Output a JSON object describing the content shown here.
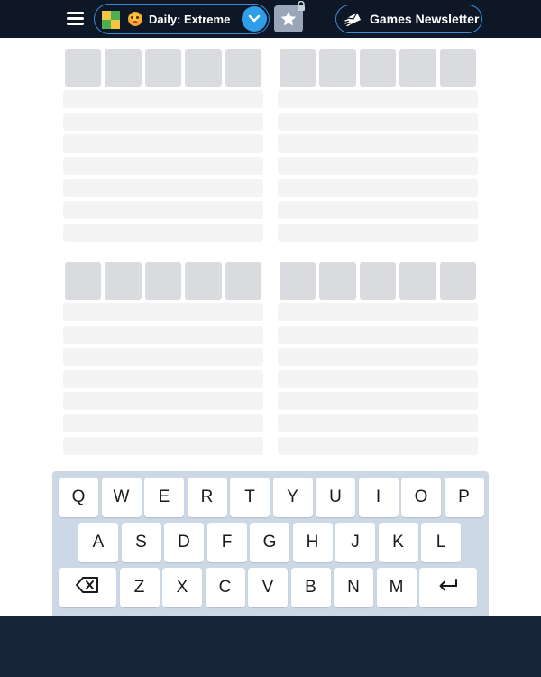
{
  "header": {
    "mode_label": "Daily: Extreme",
    "newsletter_label": "Games Newsletter",
    "icons": {
      "menu": "hamburger-icon",
      "logo": "grid-logo",
      "mode_emoji": "angry-face-emoji",
      "dropdown": "chevron-down-icon",
      "favorite": "star-icon",
      "locked": "lock-icon",
      "newsletter": "envelope-icon"
    }
  },
  "boards": [
    {
      "tiles": 5,
      "rows": 7
    },
    {
      "tiles": 5,
      "rows": 7
    },
    {
      "tiles": 5,
      "rows": 7
    },
    {
      "tiles": 5,
      "rows": 7
    }
  ],
  "keyboard": {
    "rows": [
      [
        "Q",
        "W",
        "E",
        "R",
        "T",
        "Y",
        "U",
        "I",
        "O",
        "P"
      ],
      [
        "A",
        "S",
        "D",
        "F",
        "G",
        "H",
        "J",
        "K",
        "L"
      ],
      [
        "⌫",
        "Z",
        "X",
        "C",
        "V",
        "B",
        "N",
        "M",
        "↵"
      ]
    ],
    "special_keys": {
      "⌫": "backspace-icon",
      "↵": "enter-icon"
    }
  },
  "colors": {
    "header_bg": "#0e1726",
    "accent": "#2e9ee8",
    "tile": "#dadbdf",
    "row": "#f4f4f5",
    "keyboard_bg": "#ccd8e6",
    "footer_bg": "#19253a"
  }
}
